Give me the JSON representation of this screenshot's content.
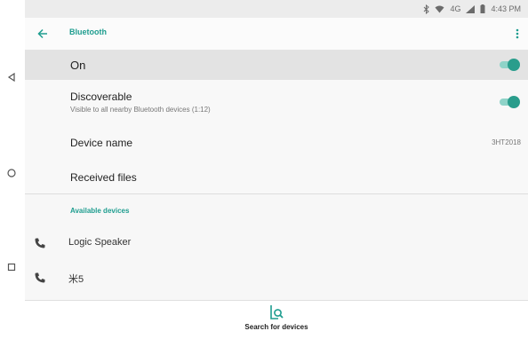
{
  "status_bar": {
    "network": "4G",
    "time": "4:43 PM"
  },
  "app_bar": {
    "title": "Bluetooth",
    "back_icon": "arrow-left-icon",
    "more_icon": "more-vert-icon"
  },
  "settings": {
    "on_label": "On",
    "on_enabled": true,
    "discoverable_label": "Discoverable",
    "discoverable_summary": "Visible to all nearby Bluetooth devices (1:12)",
    "discoverable_enabled": true,
    "device_name_label": "Device name",
    "device_name_value": "3HT2018",
    "received_files_label": "Received files"
  },
  "available": {
    "header": "Available devices",
    "devices": [
      {
        "name": "Logic Speaker",
        "icon": "phone-icon"
      },
      {
        "name": "米5",
        "icon": "phone-icon"
      }
    ]
  },
  "bottom": {
    "search_label": "Search for devices",
    "search_icon": "search-device-icon"
  },
  "colors": {
    "accent": "#1e9d8f",
    "toggle_thumb": "#2a9d8c",
    "toggle_track": "#8fd3c8"
  }
}
